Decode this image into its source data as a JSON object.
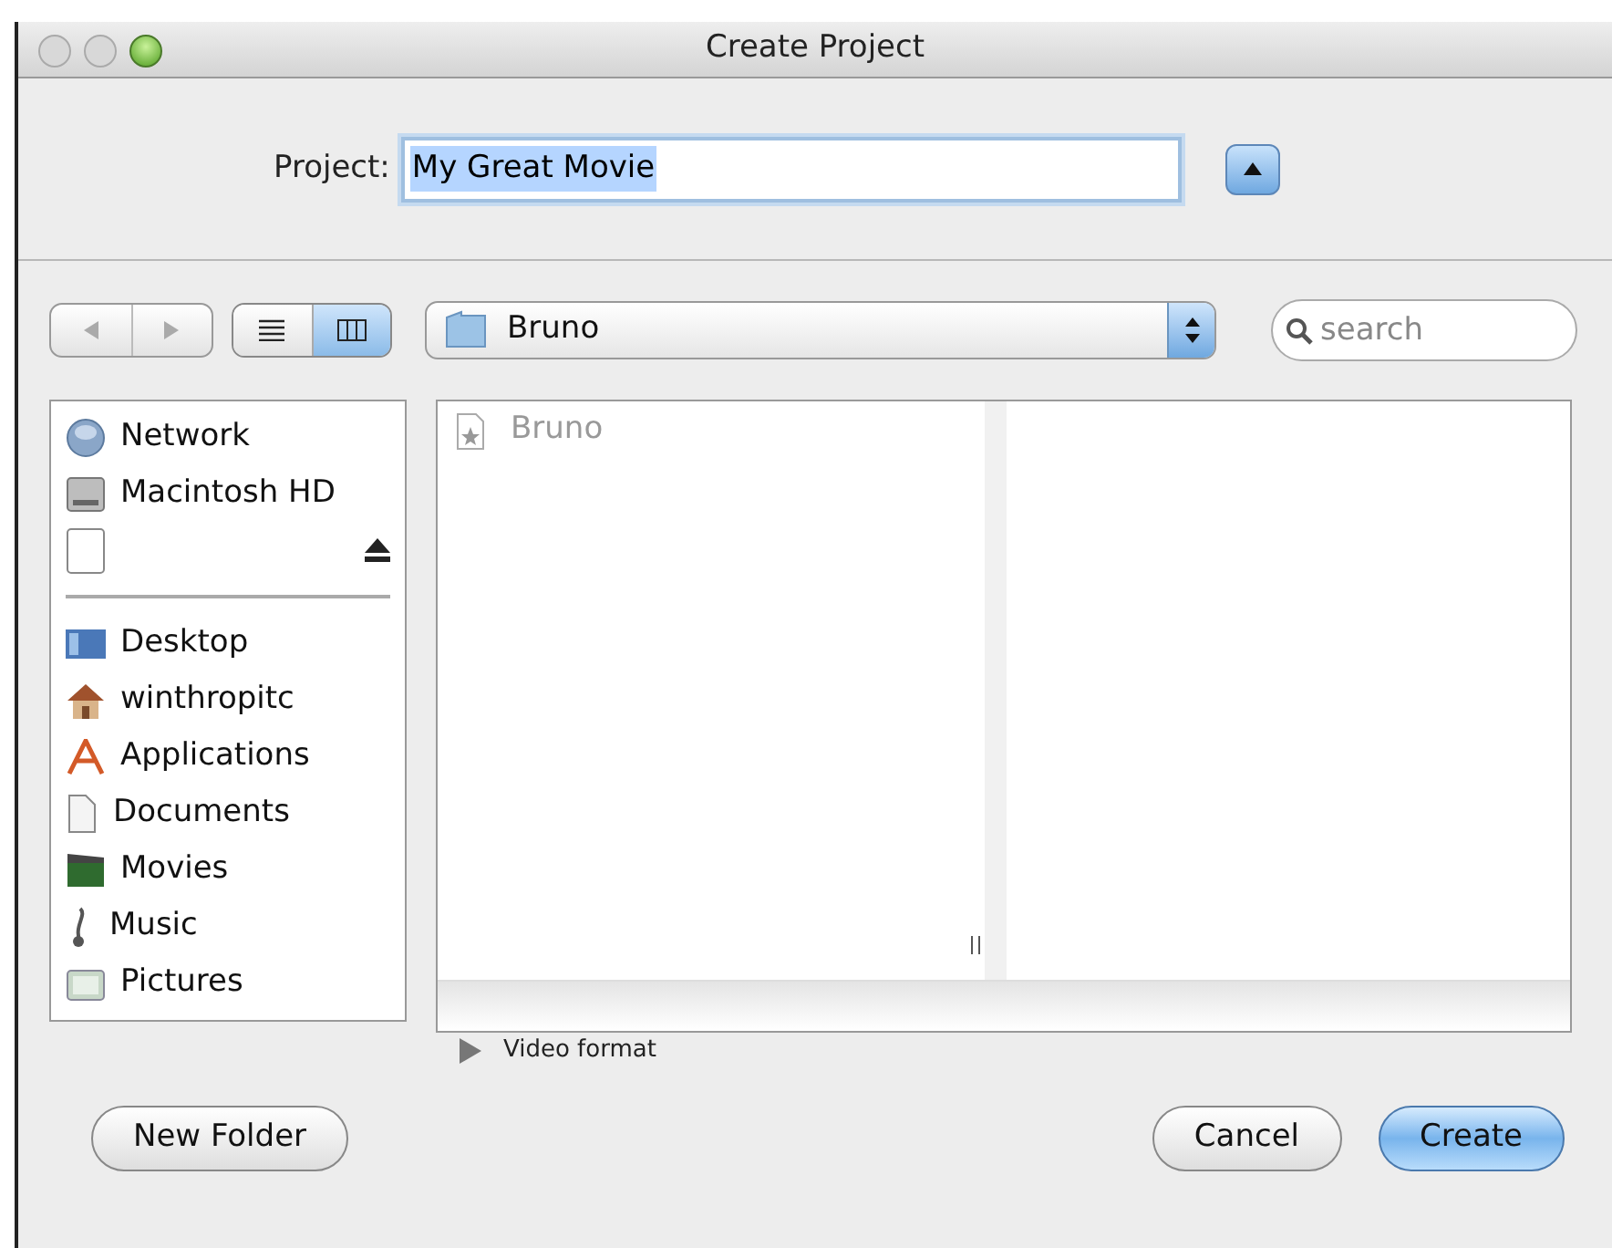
{
  "window": {
    "title": "Create Project"
  },
  "project": {
    "label": "Project:",
    "value": "My Great Movie",
    "expanded": true
  },
  "toolbar": {
    "views": [
      {
        "kind": "list",
        "selected": false
      },
      {
        "kind": "columns",
        "selected": true
      }
    ],
    "location": "Bruno",
    "search": {
      "placeholder": "search"
    }
  },
  "sidebar": {
    "devices": [
      {
        "label": "Network",
        "eject": false
      },
      {
        "label": "Macintosh HD",
        "eject": false
      },
      {
        "eject": true
      }
    ],
    "places": [
      {
        "label": "Desktop"
      },
      {
        "label": "winthropitc"
      },
      {
        "label": "Applications"
      },
      {
        "label": "Documents"
      },
      {
        "label": "Movies"
      },
      {
        "label": "Music"
      },
      {
        "label": "Pictures"
      }
    ]
  },
  "browser": {
    "columns": [
      {
        "items": [
          {
            "label": "Bruno",
            "disabled": true
          }
        ]
      },
      {}
    ]
  },
  "disclosure": {
    "label": "Video format",
    "expanded": false
  },
  "buttons": [
    {
      "label": "New Folder",
      "kind": "plain"
    },
    {
      "label": "Cancel",
      "kind": "plain"
    },
    {
      "label": "Create",
      "kind": "default"
    }
  ]
}
